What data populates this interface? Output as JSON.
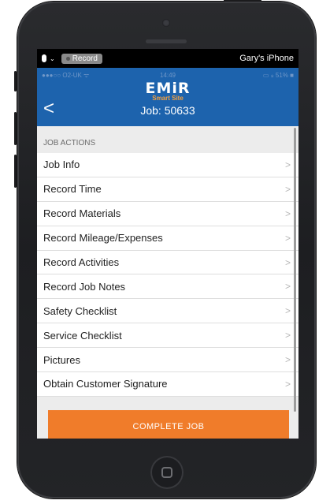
{
  "recording_bar": {
    "record_label": "Record",
    "device_name": "Gary's iPhone"
  },
  "status_bar": {
    "carrier": "●●●○○ O2-UK ᯤ",
    "time": "14:49",
    "battery": "▭ ⁎ 51% ■"
  },
  "header": {
    "logo_text": "EMiR",
    "logo_subtext": "Smart Site",
    "back_icon": "chevron-left-icon",
    "job_title": "Job: 50633"
  },
  "job_actions": {
    "section_label": "JOB ACTIONS",
    "items": [
      {
        "label": "Job Info"
      },
      {
        "label": "Record Time"
      },
      {
        "label": "Record Materials"
      },
      {
        "label": "Record Mileage/Expenses"
      },
      {
        "label": "Record Activities"
      },
      {
        "label": "Record Job Notes"
      },
      {
        "label": "Safety Checklist"
      },
      {
        "label": "Service Checklist"
      },
      {
        "label": "Pictures"
      },
      {
        "label": "Obtain Customer Signature"
      }
    ],
    "chevron": ">"
  },
  "complete_button": {
    "label": "COMPLETE JOB"
  },
  "colors": {
    "header_blue": "#1d63ad",
    "accent_orange": "#f07c2a",
    "logo_orange": "#f7a13d"
  }
}
